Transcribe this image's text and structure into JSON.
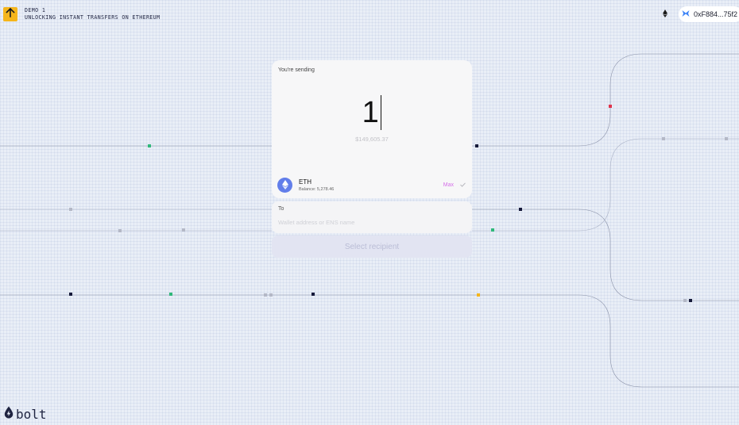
{
  "header": {
    "demo_label": "DEMO 1",
    "tagline": "UNLOCKING INSTANT TRANSFERS ON ETHEREUM",
    "wallet_address": "0xF884...75f2"
  },
  "send_card": {
    "label": "You're sending",
    "amount": "1",
    "usd_value": "$149,605.37",
    "token_symbol": "ETH",
    "balance": "Balance: 5,278.46",
    "max_label": "Max"
  },
  "recipient": {
    "label": "To",
    "placeholder": "Wallet address or ENS name",
    "value": ""
  },
  "action": {
    "label": "Select recipient"
  },
  "footer": {
    "brand": "bolt"
  },
  "icons": {
    "logo": "arrow-up-icon",
    "network": "ethereum-icon",
    "wallet": "wallet-icon",
    "token": "ethereum-icon",
    "check": "check-icon",
    "brand": "bolt-drop-icon"
  },
  "colors": {
    "accent_yellow": "#f5b51b",
    "eth_blue": "#627eea",
    "max_pink": "#d56ee8",
    "dot_green": "#2fb87a",
    "dot_red": "#e0344b",
    "dot_orange": "#f5b51b",
    "dot_navy": "#161a3a",
    "dot_grey": "#b4b8c6"
  }
}
